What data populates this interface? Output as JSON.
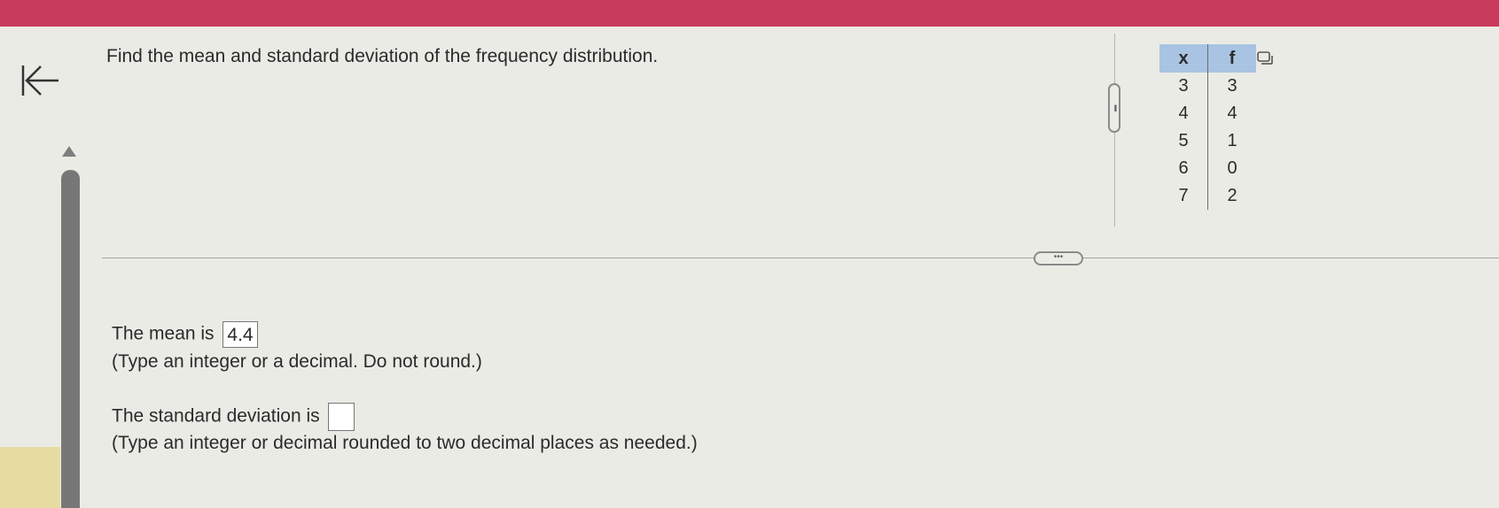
{
  "question": "Find the mean and standard deviation of the frequency distribution.",
  "table": {
    "headers": [
      "x",
      "f"
    ],
    "rows": [
      [
        "3",
        "3"
      ],
      [
        "4",
        "4"
      ],
      [
        "5",
        "1"
      ],
      [
        "6",
        "0"
      ],
      [
        "7",
        "2"
      ]
    ]
  },
  "mean": {
    "label": "The mean is",
    "value": "4.4",
    "hint": "(Type an integer or a decimal. Do not round.)"
  },
  "std": {
    "label": "The standard deviation is",
    "value": "",
    "hint": "(Type an integer or decimal rounded to two decimal places as needed.)"
  },
  "handles": {
    "horizontal": "•••",
    "vertical": "•••"
  },
  "colors": {
    "topbar": "#c83a5c",
    "table_header": "#a8c4e2",
    "scrollbar": "#777777"
  },
  "icons": {
    "back": "back-arrow-icon",
    "copy": "copy-icon"
  }
}
